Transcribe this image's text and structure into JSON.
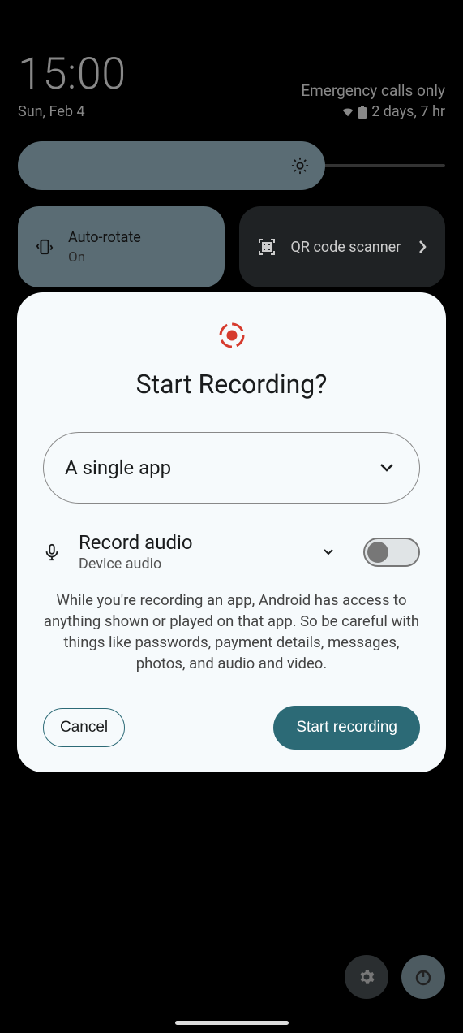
{
  "status": {
    "time": "15:00",
    "emergency": "Emergency calls only",
    "date": "Sun, Feb 4",
    "battery": "2 days, 7 hr"
  },
  "qs": {
    "autorotate": {
      "label": "Auto-rotate",
      "sub": "On"
    },
    "qr": {
      "label": "QR code scanner"
    }
  },
  "dialog": {
    "title": "Start Recording?",
    "dropdown": "A single app",
    "audio_title": "Record audio",
    "audio_sub": "Device audio",
    "warning": "While you're recording an app, Android has access to anything shown or played on that app. So be careful with things like passwords, payment details, messages, photos, and audio and video.",
    "cancel": "Cancel",
    "start": "Start recording"
  }
}
